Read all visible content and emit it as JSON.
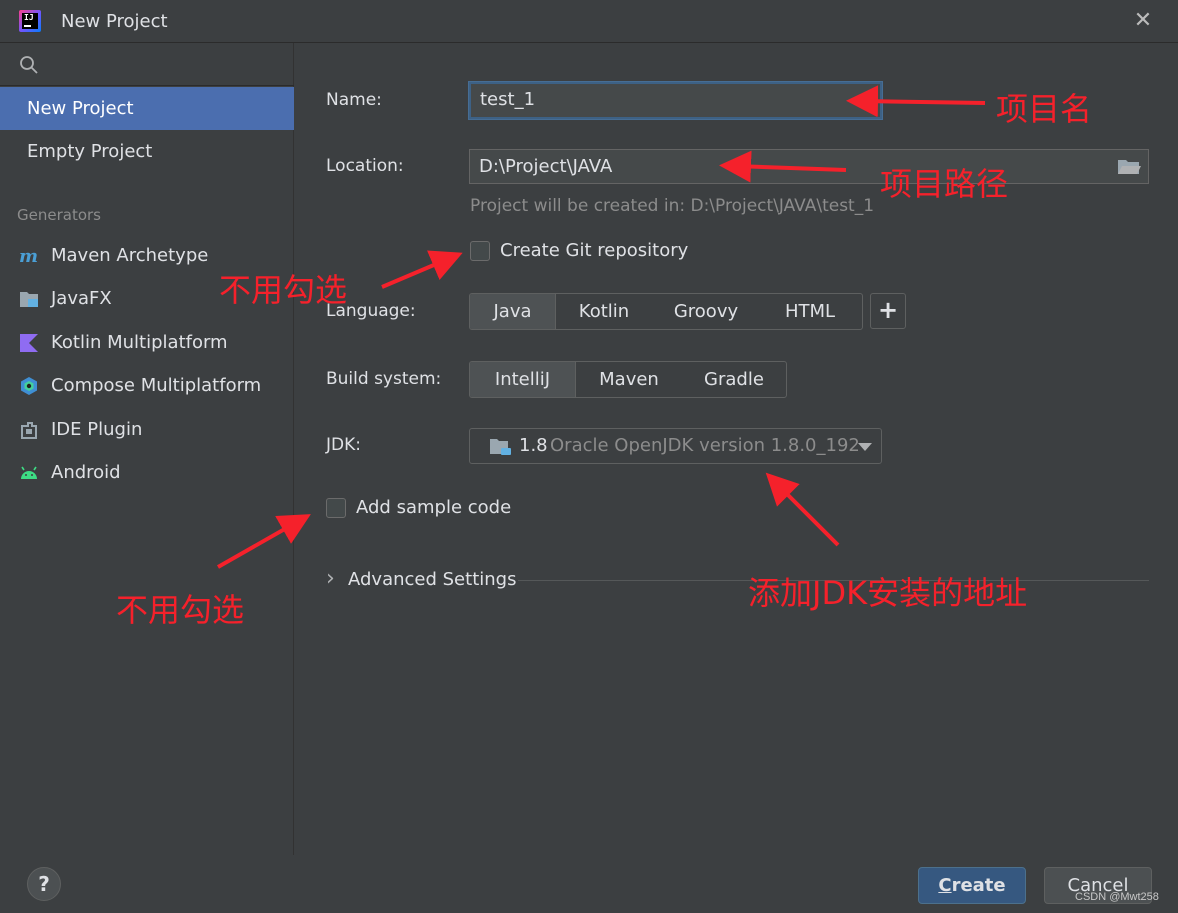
{
  "window": {
    "title": "New Project",
    "close_glyph": "✕"
  },
  "sidebar": {
    "search_icon": "search-icon",
    "items": [
      {
        "label": "New Project",
        "selected": true
      },
      {
        "label": "Empty Project",
        "selected": false
      }
    ],
    "generators_heading": "Generators",
    "generators": [
      {
        "label": "Maven Archetype",
        "icon": "maven-icon"
      },
      {
        "label": "JavaFX",
        "icon": "javafx-icon"
      },
      {
        "label": "Kotlin Multiplatform",
        "icon": "kotlin-icon"
      },
      {
        "label": "Compose Multiplatform",
        "icon": "compose-icon"
      },
      {
        "label": "IDE Plugin",
        "icon": "plugin-icon"
      },
      {
        "label": "Android",
        "icon": "android-icon"
      }
    ]
  },
  "form": {
    "name_label": "Name:",
    "name_value": "test_1",
    "location_label": "Location:",
    "location_value": "D:\\Project\\JAVA",
    "location_hint": "Project will be created in: D:\\Project\\JAVA\\test_1",
    "git_label": "Create Git repository",
    "git_checked": false,
    "language_label": "Language:",
    "languages": [
      "Java",
      "Kotlin",
      "Groovy",
      "HTML"
    ],
    "language_selected": "Java",
    "add_glyph": "+",
    "build_label": "Build system:",
    "build_systems": [
      "IntelliJ",
      "Maven",
      "Gradle"
    ],
    "build_selected": "IntelliJ",
    "jdk_label": "JDK:",
    "jdk_version": "1.8",
    "jdk_name": "Oracle OpenJDK version 1.8.0_192",
    "sample_label": "Add sample code",
    "sample_checked": false,
    "advanced_label": "Advanced Settings",
    "advanced_glyph": "›"
  },
  "buttons": {
    "help_glyph": "?",
    "create_mnemonic": "C",
    "create_rest": "reate",
    "cancel": "Cancel"
  },
  "watermark": "CSDN @Mwt258",
  "annotations": {
    "project_name": "项目名",
    "project_path": "项目路径",
    "no_check_1": "不用勾选",
    "no_check_2": "不用勾选",
    "jdk_address": "添加JDK安装的地址"
  },
  "colors": {
    "background": "#3c3f41",
    "selection": "#4b6eaf",
    "primary_button": "#365880",
    "annotation": "#f5212b"
  }
}
